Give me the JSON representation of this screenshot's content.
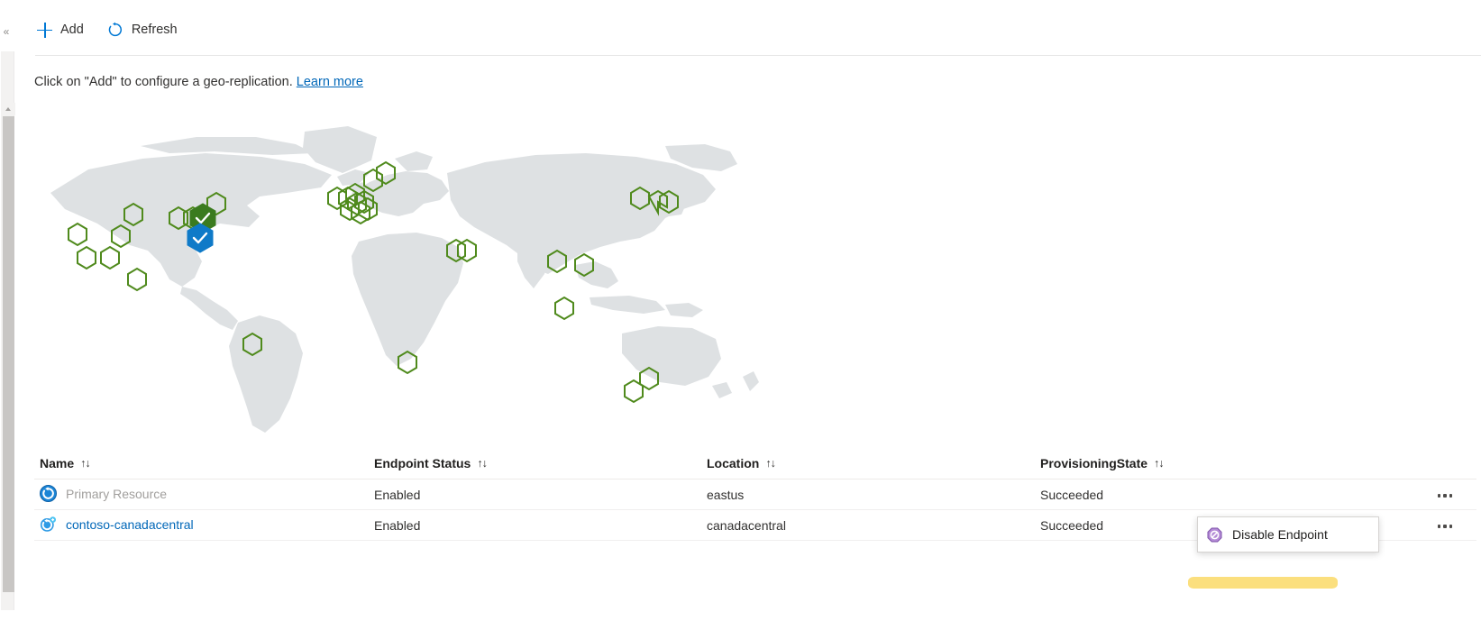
{
  "window": {
    "collapse_chevron": "«"
  },
  "toolbar": {
    "add_label": "Add",
    "refresh_label": "Refresh",
    "add_icon": "plus-icon",
    "refresh_icon": "refresh-icon"
  },
  "description": {
    "text": "Click on \"Add\" to configure a geo-replication.",
    "link_label": "Learn more"
  },
  "map": {
    "land_color": "#dee1e3",
    "hex_outline_color": "#4f8a1c",
    "primary_fill_color": "#3b7b1f",
    "replica_fill_color": "#0f7ac8",
    "check_glyph": "✓",
    "available_region_markers": 33,
    "selected_markers": [
      {
        "name": "eastus",
        "state": "primary",
        "color": "#3b7b1f"
      },
      {
        "name": "canadacentral",
        "state": "replica",
        "color": "#0f7ac8"
      }
    ]
  },
  "table": {
    "sort_glyph": "↑↓",
    "columns": [
      {
        "key": "name",
        "label": "Name",
        "sortable": true
      },
      {
        "key": "endpoint_status",
        "label": "Endpoint Status",
        "sortable": true
      },
      {
        "key": "location",
        "label": "Location",
        "sortable": true
      },
      {
        "key": "provisioning_state",
        "label": "ProvisioningState",
        "sortable": true
      }
    ],
    "rows": [
      {
        "name": "Primary Resource",
        "name_style": "disabled",
        "icon": "container-registry-icon",
        "endpoint_status": "Enabled",
        "location": "eastus",
        "provisioning_state": "Succeeded",
        "menu_label": "•••"
      },
      {
        "name": "contoso-canadacentral",
        "name_style": "link",
        "icon": "replication-icon",
        "endpoint_status": "Enabled",
        "location": "canadacentral",
        "provisioning_state": "Succeeded",
        "menu_label": "•••"
      }
    ]
  },
  "context_menu": {
    "items": [
      {
        "label": "Disable Endpoint",
        "icon": "disable-endpoint-icon"
      }
    ]
  },
  "annotation": {
    "highlight_color": "#fbdf7e"
  },
  "colors": {
    "accent": "#0078d4",
    "link": "#0067b8",
    "text": "#323130",
    "muted": "#a19f9d",
    "map_land": "#dee1e3",
    "hex_green": "#4f8a1c"
  }
}
